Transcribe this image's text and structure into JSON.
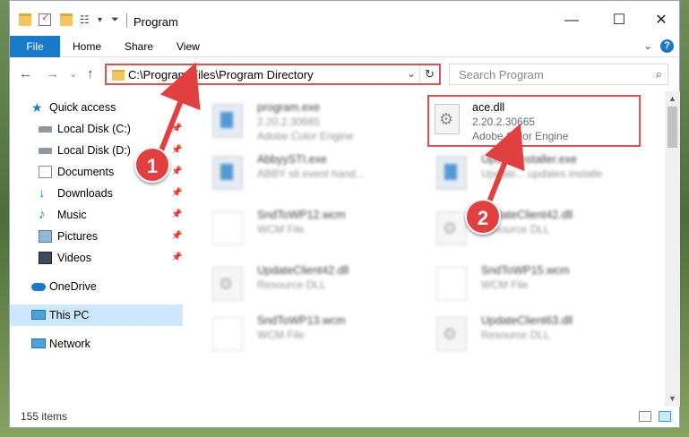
{
  "window": {
    "title": "Program",
    "controls": {
      "minimize": "—",
      "maximize": "☐",
      "close": "✕"
    }
  },
  "ribbon": {
    "tabs": [
      {
        "label": "File"
      },
      {
        "label": "Home"
      },
      {
        "label": "Share"
      },
      {
        "label": "View"
      }
    ],
    "expand": "⌄",
    "help": "?"
  },
  "navigation": {
    "back": "←",
    "forward": "→",
    "recent": "⌄",
    "up": "↑",
    "address": "C:\\Program Files\\Program Directory",
    "address_dropdown": "⌄",
    "refresh": "↻",
    "search_placeholder": "Search Program",
    "search_icon": "⌕"
  },
  "sidebar": {
    "items": [
      {
        "label": "Quick access",
        "icon": "star-icon"
      },
      {
        "label": "Local Disk (C:)",
        "icon": "drive-icon",
        "pinned": true
      },
      {
        "label": "Local Disk (D:)",
        "icon": "drive-icon",
        "pinned": true
      },
      {
        "label": "Documents",
        "icon": "documents-icon",
        "pinned": true
      },
      {
        "label": "Downloads",
        "icon": "download-icon",
        "pinned": true
      },
      {
        "label": "Music",
        "icon": "music-icon",
        "pinned": true
      },
      {
        "label": "Pictures",
        "icon": "pictures-icon",
        "pinned": true
      },
      {
        "label": "Videos",
        "icon": "videos-icon",
        "pinned": true
      },
      {
        "label": "OneDrive",
        "icon": "cloud-icon"
      },
      {
        "label": "This PC",
        "icon": "computer-icon",
        "selected": true
      },
      {
        "label": "Network",
        "icon": "network-icon"
      }
    ],
    "pin_glyph": "📌"
  },
  "files": [
    {
      "name": "program.exe",
      "line2": "2.20.2.30665",
      "line3": "Adobe Color Engine",
      "icon": "program-icon",
      "blurred": true
    },
    {
      "name": "ace.dll",
      "line2": "2.20.2.30665",
      "line3": "Adobe Color Engine",
      "icon": "dll-gear-icon",
      "blurred": false,
      "highlighted": true
    },
    {
      "name": "AbbyySTI.exe",
      "line2": "ABBY sti event hand...",
      "line3": "",
      "icon": "exe-icon",
      "blurred": true
    },
    {
      "name": "UpdateInstaller.exe",
      "line2": "Update... updates installe",
      "line3": "",
      "icon": "exe-icon",
      "blurred": true
    },
    {
      "name": "SndToWP12.wcm",
      "line2": "WCM File",
      "line3": "",
      "icon": "document-icon",
      "blurred": true
    },
    {
      "name": "UpdateClient42.dll",
      "line2": "Resource DLL",
      "line3": "",
      "icon": "dll-gear-icon",
      "blurred": true
    },
    {
      "name": "UpdateClient42.dll",
      "line2": "Resource DLL",
      "line3": "",
      "icon": "dll-gear-icon",
      "blurred": true
    },
    {
      "name": "SndToWP15.wcm",
      "line2": "WCM File",
      "line3": "",
      "icon": "document-icon",
      "blurred": true
    },
    {
      "name": "SndToWP13.wcm",
      "line2": "WCM File",
      "line3": "",
      "icon": "document-icon",
      "blurred": true
    },
    {
      "name": "UpdateClient63.dll",
      "line2": "Resource DLL",
      "line3": "",
      "icon": "dll-gear-icon",
      "blurred": true
    }
  ],
  "status": {
    "count": "155 items"
  },
  "annotations": {
    "step1": "1",
    "step2": "2"
  },
  "colors": {
    "accent": "#1979ca",
    "highlight": "#e05050",
    "badge": "#e24040",
    "selected": "#cce8ff"
  }
}
